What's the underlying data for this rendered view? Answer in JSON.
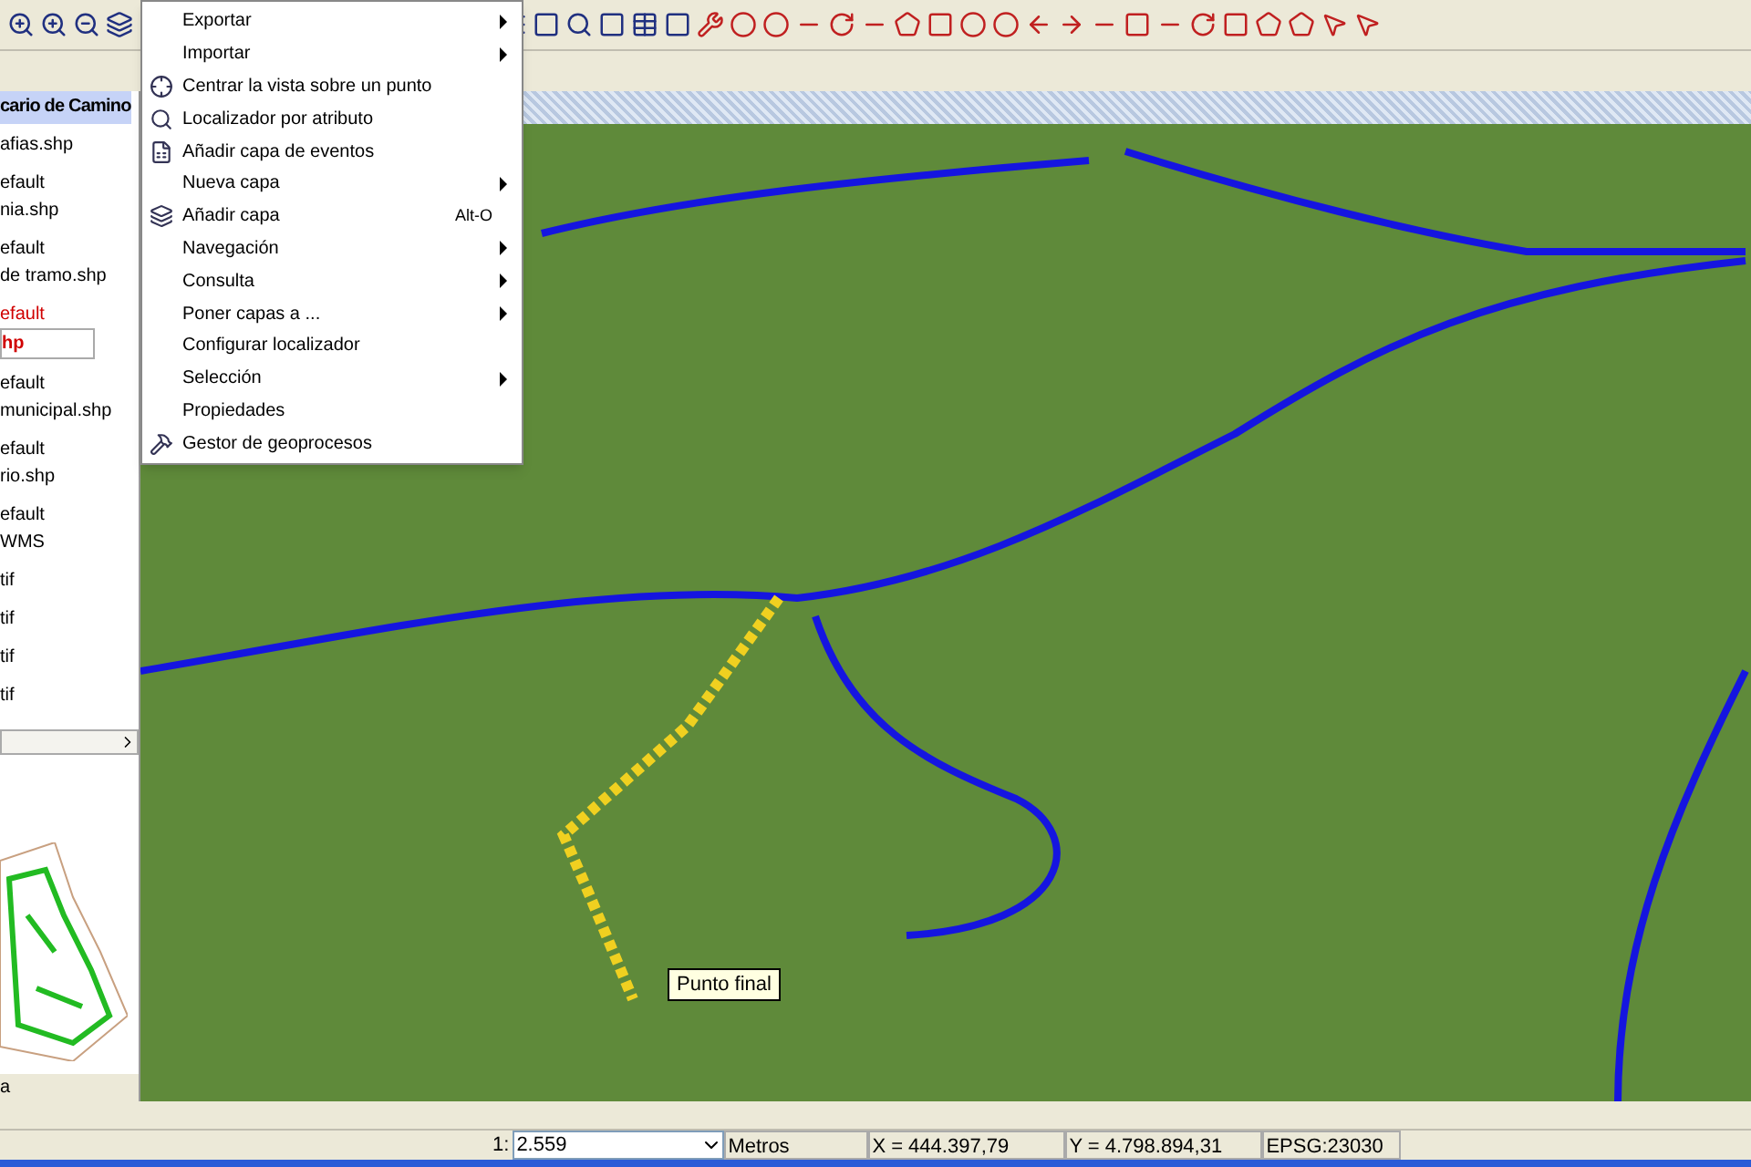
{
  "menu": [
    {
      "label": "Exportar",
      "submenu": true
    },
    {
      "label": "Importar",
      "submenu": true
    },
    {
      "label": "Centrar la vista sobre un punto",
      "submenu": false
    },
    {
      "label": "Localizador por atributo",
      "submenu": false
    },
    {
      "label": "Añadir capa de eventos",
      "submenu": false
    },
    {
      "label": "Nueva capa",
      "submenu": true
    },
    {
      "label": "Añadir capa",
      "submenu": false,
      "shortcut": "Alt-O"
    },
    {
      "label": "Navegación",
      "submenu": true
    },
    {
      "label": "Consulta",
      "submenu": true
    },
    {
      "label": "Poner capas a ...",
      "submenu": true
    },
    {
      "label": "Configurar localizador",
      "submenu": false
    },
    {
      "label": "Selección",
      "submenu": true
    },
    {
      "label": "Propiedades",
      "submenu": false
    },
    {
      "label": "Gestor de geoprocesos",
      "submenu": false
    }
  ],
  "toc": {
    "title": "cario de Camino",
    "layers": [
      {
        "lines": [
          "afias.shp"
        ],
        "selected": false
      },
      {
        "lines": [
          "efault",
          "nia.shp"
        ],
        "selected": false
      },
      {
        "lines": [
          "efault",
          "de tramo.shp"
        ],
        "selected": false
      },
      {
        "lines": [
          "efault",
          "hp"
        ],
        "selected": true
      },
      {
        "lines": [
          "efault",
          "municipal.shp"
        ],
        "selected": false
      },
      {
        "lines": [
          "efault",
          "rio.shp"
        ],
        "selected": false
      },
      {
        "lines": [
          "efault",
          "WMS"
        ],
        "selected": false
      },
      {
        "lines": [
          "tif"
        ],
        "selected": false
      },
      {
        "lines": [
          "tif"
        ],
        "selected": false
      },
      {
        "lines": [
          "tif"
        ],
        "selected": false
      },
      {
        "lines": [
          "tif"
        ],
        "selected": false
      }
    ],
    "footer": "a"
  },
  "map": {
    "tooltip": "Punto final"
  },
  "status_bar": {
    "scale_prefix": "1:",
    "scale": "2.559",
    "units": "Metros",
    "x": "X = 444.397,79",
    "y": "Y = 4.798.894,31",
    "crs": "EPSG:23030"
  }
}
